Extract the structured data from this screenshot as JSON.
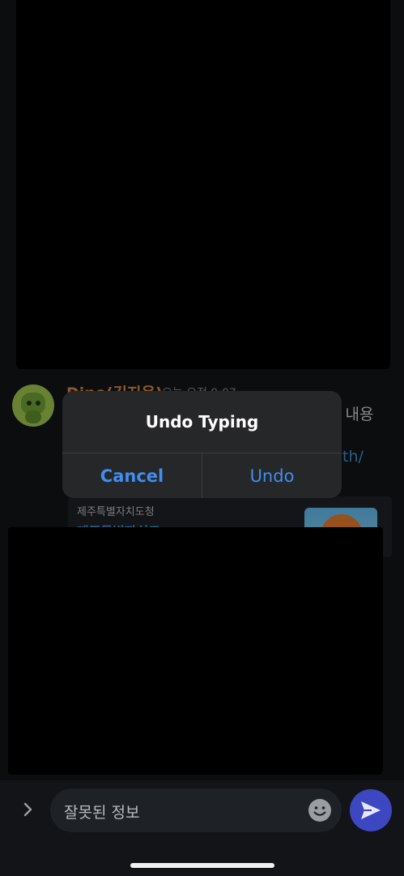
{
  "message": {
    "sender": "Dino(김지용)",
    "time": "오늘 오전 9:07",
    "text_fragment": "된 내용",
    "link_fragment": "uth/"
  },
  "link_preview": {
    "source": "제주특별자치도청",
    "title": "제주특별자치도"
  },
  "alert": {
    "title": "Undo Typing",
    "cancel_label": "Cancel",
    "undo_label": "Undo"
  },
  "composer": {
    "input_value": "잘못된 정보"
  },
  "icons": {
    "expand": "chevron-right-icon",
    "emoji": "emoji-icon",
    "send": "send-icon"
  },
  "colors": {
    "background": "#121417",
    "sender_name": "#d4833f",
    "link": "#3a8fd0",
    "alert_button": "#3f8ef0",
    "send_button": "#3e47c2"
  }
}
